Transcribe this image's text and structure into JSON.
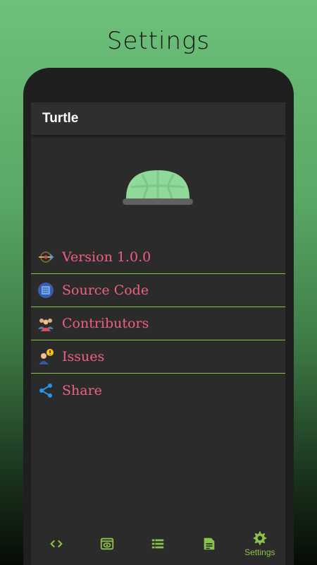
{
  "promo": {
    "title": "Settings"
  },
  "appbar": {
    "title": "Turtle"
  },
  "menu": {
    "items": [
      {
        "label": "Version 1.0.0",
        "icon": "version-icon"
      },
      {
        "label": "Source Code",
        "icon": "source-code-icon"
      },
      {
        "label": "Contributors",
        "icon": "contributors-icon"
      },
      {
        "label": "Issues",
        "icon": "issues-icon"
      },
      {
        "label": "Share",
        "icon": "share-icon"
      }
    ]
  },
  "bottom_nav": {
    "items": [
      {
        "icon": "code-icon",
        "label": ""
      },
      {
        "icon": "preview-icon",
        "label": ""
      },
      {
        "icon": "list-icon",
        "label": ""
      },
      {
        "icon": "document-icon",
        "label": ""
      },
      {
        "icon": "settings-icon",
        "label": "Settings",
        "selected": true
      }
    ]
  },
  "colors": {
    "accent": "#8bc34a",
    "menu_text": "#f06080",
    "logo_shell": "#8fd99b",
    "logo_base": "#616161"
  }
}
